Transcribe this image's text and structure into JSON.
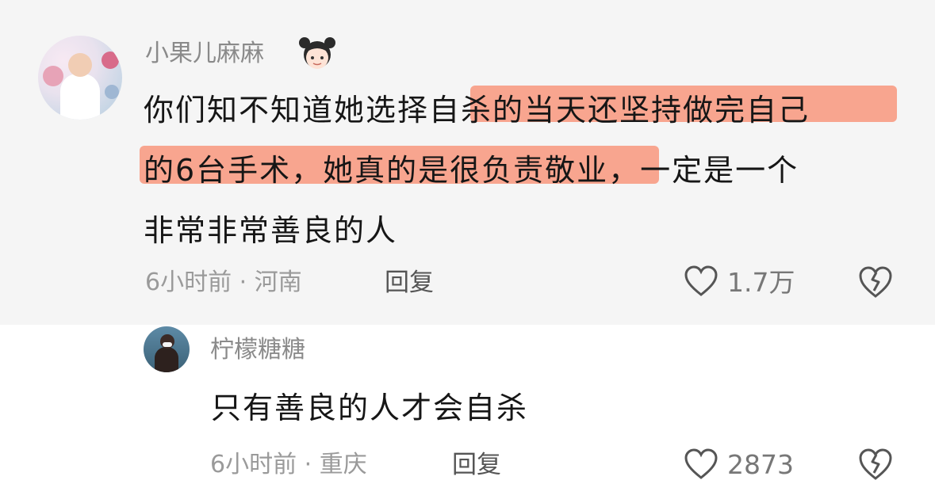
{
  "comment": {
    "username": "小果儿麻麻",
    "username_emoji": "girl-emoji",
    "text_line1": "你们知不知道她选择自杀的当天还坚持做完自己",
    "text_line2": "的6台手术，她真的是很负责敬业，一定是一个",
    "text_line3": "非常非常善良的人",
    "meta": "6小时前 · 河南",
    "reply_label": "回复",
    "likes": "1.7万"
  },
  "reply": {
    "username": "柠檬糖糖",
    "text": "只有善良的人才会自杀",
    "meta": "6小时前 · 重庆",
    "reply_label": "回复",
    "likes": "2873"
  },
  "colors": {
    "highlight": "#f8a58f",
    "background_top": "#f5f5f5",
    "background_bottom": "#ffffff",
    "text": "#161616",
    "muted": "#9a9a9a"
  }
}
